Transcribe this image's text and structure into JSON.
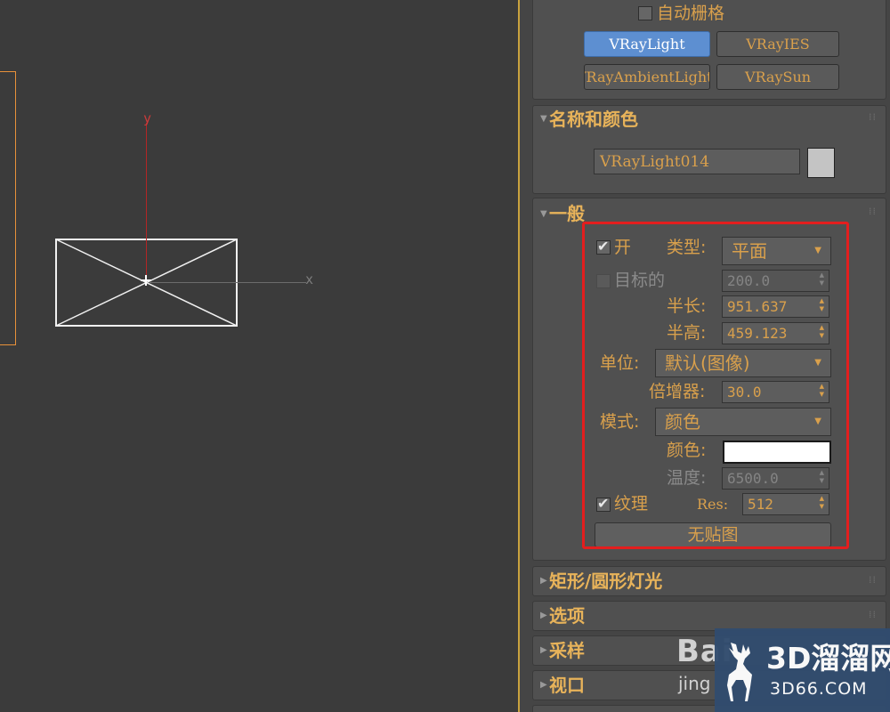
{
  "viewport": {
    "axis_x": "x",
    "axis_y": "y"
  },
  "object_type": {
    "autogrid": "自动栅格",
    "buttons": [
      "VRayLight",
      "VRayIES",
      "VRayAmbientLight",
      "VRaySun"
    ]
  },
  "name_color": {
    "title": "名称和颜色",
    "object_name": "VRayLight014",
    "swatch_color": "#c4c4c4"
  },
  "general": {
    "title": "一般",
    "on_label": "开",
    "type_label": "类型:",
    "type_value": "平面",
    "targeted_label": "目标的",
    "target_value": "200.0",
    "half_length_label": "半长:",
    "half_length_value": "951.637",
    "half_height_label": "半高:",
    "half_height_value": "459.123",
    "units_label": "单位:",
    "units_value": "默认(图像)",
    "multiplier_label": "倍增器:",
    "multiplier_value": "30.0",
    "mode_label": "模式:",
    "mode_value": "颜色",
    "color_label": "颜色:",
    "color_value": "#ffffff",
    "temperature_label": "温度:",
    "temperature_value": "6500.0",
    "texture_label": "纹理",
    "res_label": "Res:",
    "res_value": "512",
    "no_map": "无贴图"
  },
  "rollouts": {
    "rect_disc": "矩形/圆形灯光",
    "options": "选项",
    "sampling": "采样",
    "viewport": "视口"
  },
  "watermarks": {
    "baidu": "Bai",
    "baidu_sub": "jing",
    "logo_title": "3D溜溜网",
    "logo_url": "3D66.COM"
  },
  "colors": {
    "accent_orange": "#d9a04c",
    "active_blue": "#5d8fd1",
    "highlight_red": "#e31e1e"
  }
}
